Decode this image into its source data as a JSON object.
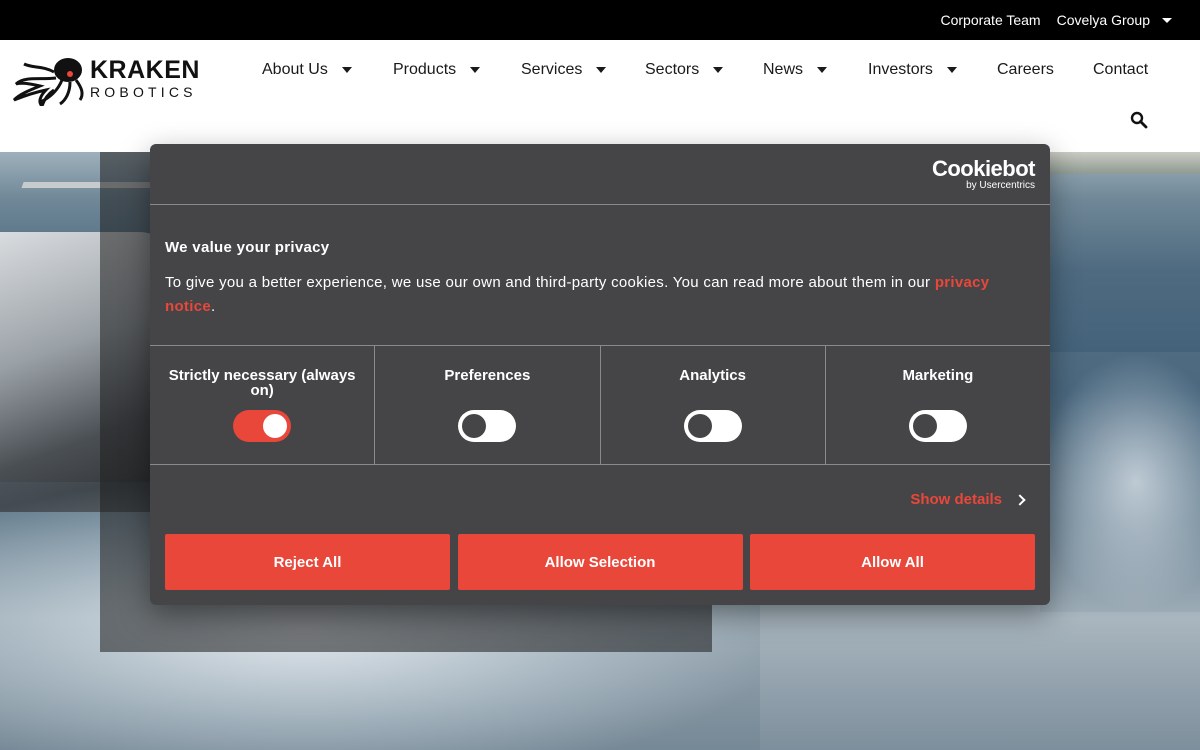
{
  "topbar": {
    "corporate_team": "Corporate Team",
    "covelya_group": "Covelya Group"
  },
  "logo": {
    "line1": "KRAKEN",
    "line2": "ROBOTICS"
  },
  "nav": {
    "items": [
      {
        "label": "About Us",
        "has_dropdown": true
      },
      {
        "label": "Products",
        "has_dropdown": true
      },
      {
        "label": "Services",
        "has_dropdown": true
      },
      {
        "label": "Sectors",
        "has_dropdown": true
      },
      {
        "label": "News",
        "has_dropdown": true
      },
      {
        "label": "Investors",
        "has_dropdown": true
      },
      {
        "label": "Careers",
        "has_dropdown": false
      },
      {
        "label": "Contact",
        "has_dropdown": false
      }
    ],
    "search_icon": "search-icon"
  },
  "cookie_dialog": {
    "brand": "Cookiebot",
    "brand_sub": "by Usercentrics",
    "title": "We value your privacy",
    "text_before_link": "To give you a better experience, we use our own and third-party cookies. You can read more about them in our ",
    "link_text": "privacy notice",
    "text_after_link": ".",
    "toggles": [
      {
        "label": "Strictly necessary (always on)",
        "on": true
      },
      {
        "label": "Preferences",
        "on": false
      },
      {
        "label": "Analytics",
        "on": false
      },
      {
        "label": "Marketing",
        "on": false
      }
    ],
    "show_details": "Show details",
    "buttons": {
      "reject": "Reject All",
      "allow_selection": "Allow Selection",
      "allow_all": "Allow All"
    }
  },
  "colors": {
    "accent": "#e8473a",
    "dialog_bg": "#454547",
    "topbar_bg": "#000000"
  }
}
